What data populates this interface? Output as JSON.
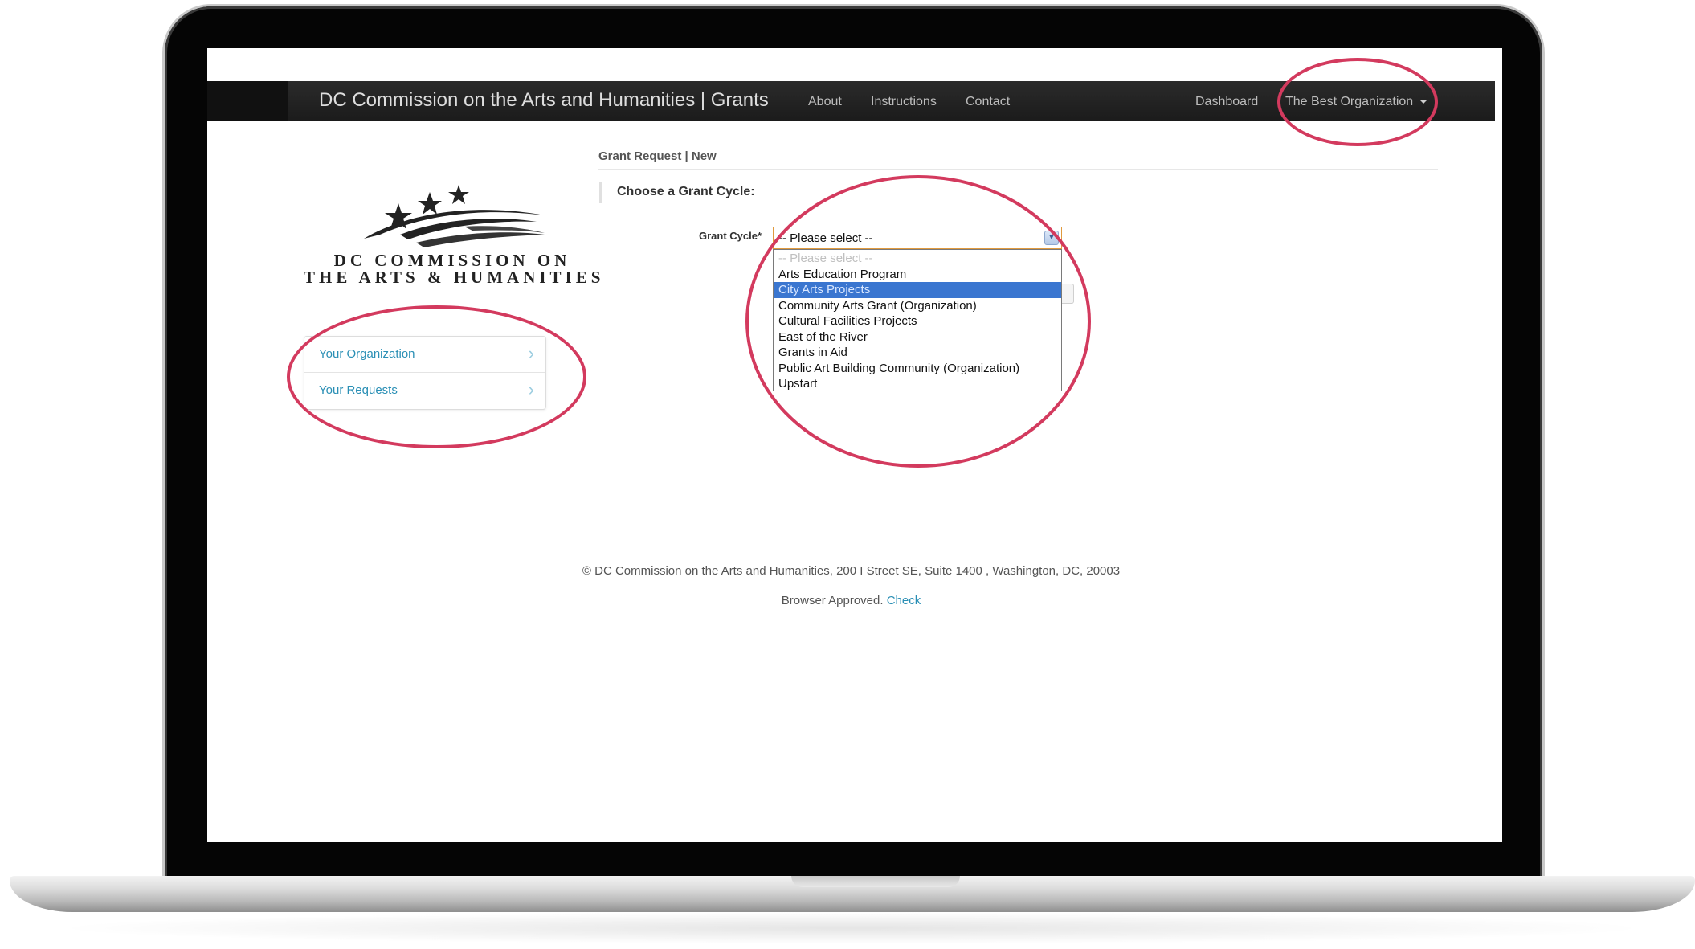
{
  "navbar": {
    "brand": "DC Commission on the Arts and Humanities | Grants",
    "links": [
      "About",
      "Instructions",
      "Contact"
    ],
    "dashboard": "Dashboard",
    "account": "The Best Organization"
  },
  "logo": {
    "line1": "DC COMMISSION ON",
    "line2": "THE ARTS & HUMANITIES"
  },
  "sidebar": {
    "items": [
      {
        "label": "Your Organization"
      },
      {
        "label": "Your Requests"
      }
    ]
  },
  "main": {
    "breadcrumb": "Grant Request | New",
    "section_title": "Choose a Grant Cycle:",
    "field_label": "Grant Cycle*",
    "select_value": "-- Please select --",
    "options": [
      "-- Please select --",
      "Arts Education Program",
      "City Arts Projects",
      "Community Arts Grant (Organization)",
      "Cultural Facilities Projects",
      "East of the River",
      "Grants in Aid",
      "Public Art Building Community (Organization)",
      "Upstart"
    ],
    "highlighted_option": "City Arts Projects"
  },
  "footer": {
    "address": "© DC Commission on the Arts and Humanities, 200 I Street SE, Suite 1400 , Washington, DC, 20003",
    "browser_text": "Browser Approved.",
    "check_link": "Check"
  },
  "colors": {
    "annotation": "#d33a5e",
    "link": "#2a8fb5",
    "highlight": "#3a76d0"
  }
}
